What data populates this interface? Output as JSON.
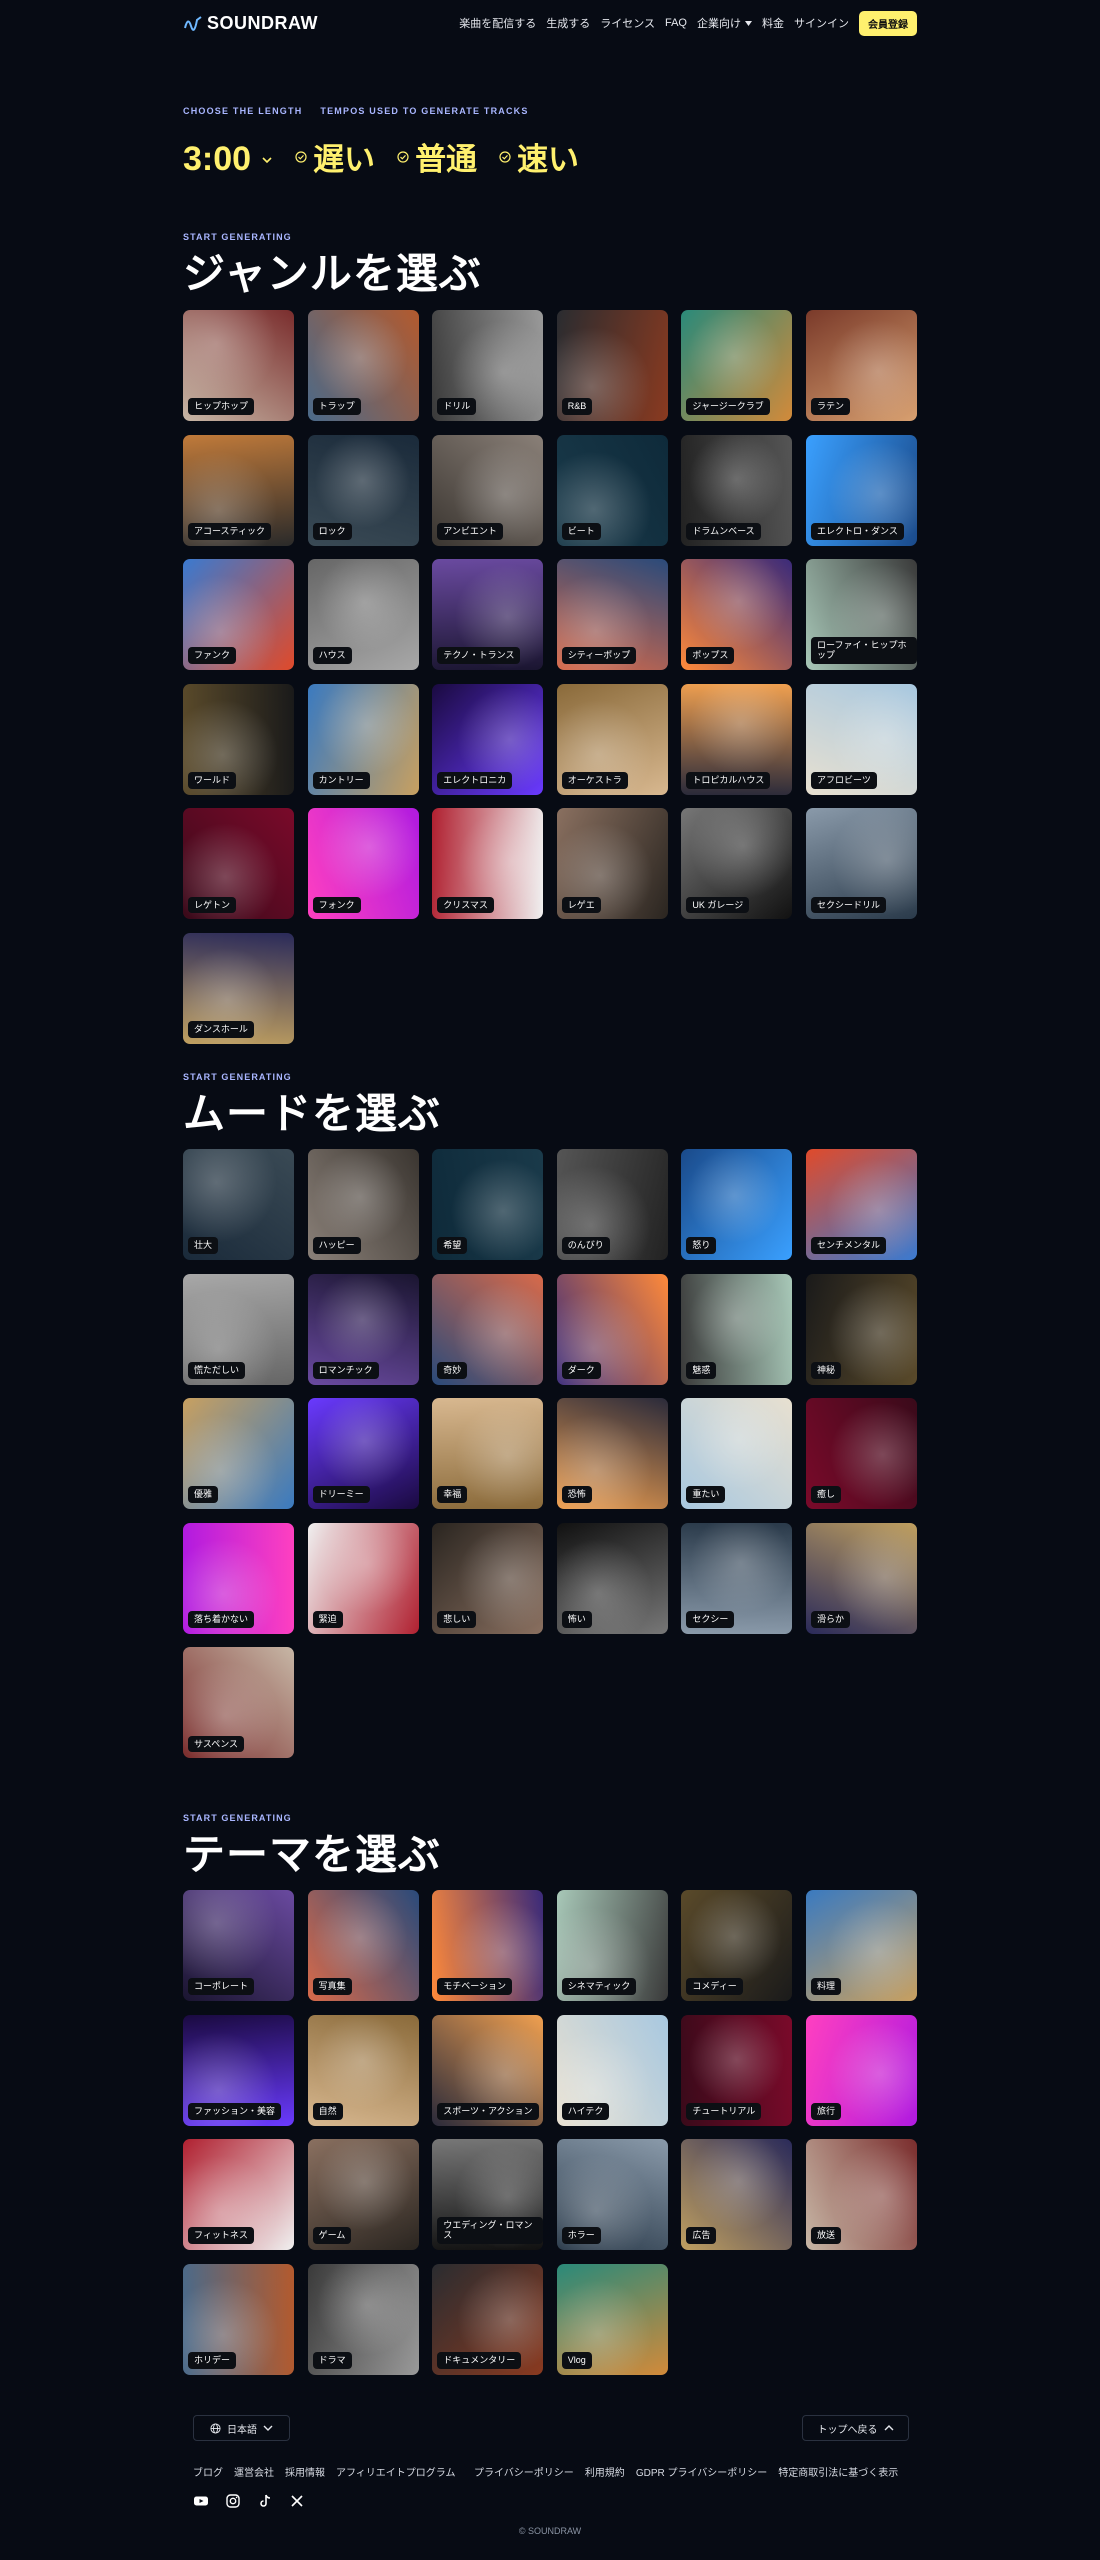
{
  "header": {
    "logo_text": "SOUNDRAW",
    "nav": [
      "楽曲を配信する",
      "生成する",
      "ライセンス",
      "FAQ",
      "企業向け",
      "料金",
      "サインイン"
    ],
    "cta": "会員登録"
  },
  "tempo_section": {
    "length_label": "CHOOSE THE LENGTH",
    "tempo_label": "TEMPOS USED TO GENERATE TRACKS",
    "duration": "3:00",
    "tempos": [
      "遅い",
      "普通",
      "速い"
    ]
  },
  "sections": [
    {
      "eyebrow": "START GENERATING",
      "title": "ジャンルを選ぶ",
      "items": [
        "ヒップホップ",
        "トラップ",
        "ドリル",
        "R&B",
        "ジャージークラブ",
        "ラテン",
        "アコースティック",
        "ロック",
        "アンビエント",
        "ビート",
        "ドラムンベース",
        "エレクトロ・ダンス",
        "ファンク",
        "ハウス",
        "テクノ・トランス",
        "シティーポップ",
        "ポップス",
        "ローファイ・ヒップホップ",
        "ワールド",
        "カントリー",
        "エレクトロニカ",
        "オーケストラ",
        "トロピカルハウス",
        "アフロビーツ",
        "レゲトン",
        "フォンク",
        "クリスマス",
        "レゲエ",
        "UK ガレージ",
        "セクシードリル",
        "ダンスホール"
      ]
    },
    {
      "eyebrow": "START GENERATING",
      "title": "ムードを選ぶ",
      "items": [
        "壮大",
        "ハッピー",
        "希望",
        "のんびり",
        "怒り",
        "センチメンタル",
        "慌ただしい",
        "ロマンチック",
        "奇妙",
        "ダーク",
        "魅惑",
        "神秘",
        "優雅",
        "ドリーミー",
        "幸福",
        "恐怖",
        "重たい",
        "癒し",
        "落ち着かない",
        "緊迫",
        "悲しい",
        "怖い",
        "セクシー",
        "滑らか",
        "サスペンス"
      ]
    },
    {
      "eyebrow": "START GENERATING",
      "title": "テーマを選ぶ",
      "items": [
        "コーポレート",
        "写真集",
        "モチベーション",
        "シネマティック",
        "コメディー",
        "料理",
        "ファッション・美容",
        "自然",
        "スポーツ・アクション",
        "ハイテク",
        "チュートリアル",
        "旅行",
        "フィットネス",
        "ゲーム",
        "ウエディング・ロマンス",
        "ホラー",
        "広告",
        "放送",
        "ホリデー",
        "ドラマ",
        "ドキュメンタリー",
        "Vlog"
      ]
    }
  ],
  "footer": {
    "language": "日本語",
    "back_to_top": "トップへ戻る",
    "links_left": [
      "ブログ",
      "運営会社",
      "採用情報",
      "アフィリエイトプログラム"
    ],
    "links_right": [
      "プライバシーポリシー",
      "利用規約",
      "GDPR プライバシーポリシー",
      "特定商取引法に基づく表示"
    ],
    "social": [
      "youtube-icon",
      "instagram-icon",
      "tiktok-icon",
      "x-icon"
    ],
    "copyright": "© SOUNDRAW"
  },
  "colors": {
    "background": "#070b14",
    "accent_yellow": "#fff06e",
    "eyebrow_blue": "#a9b6ff"
  }
}
